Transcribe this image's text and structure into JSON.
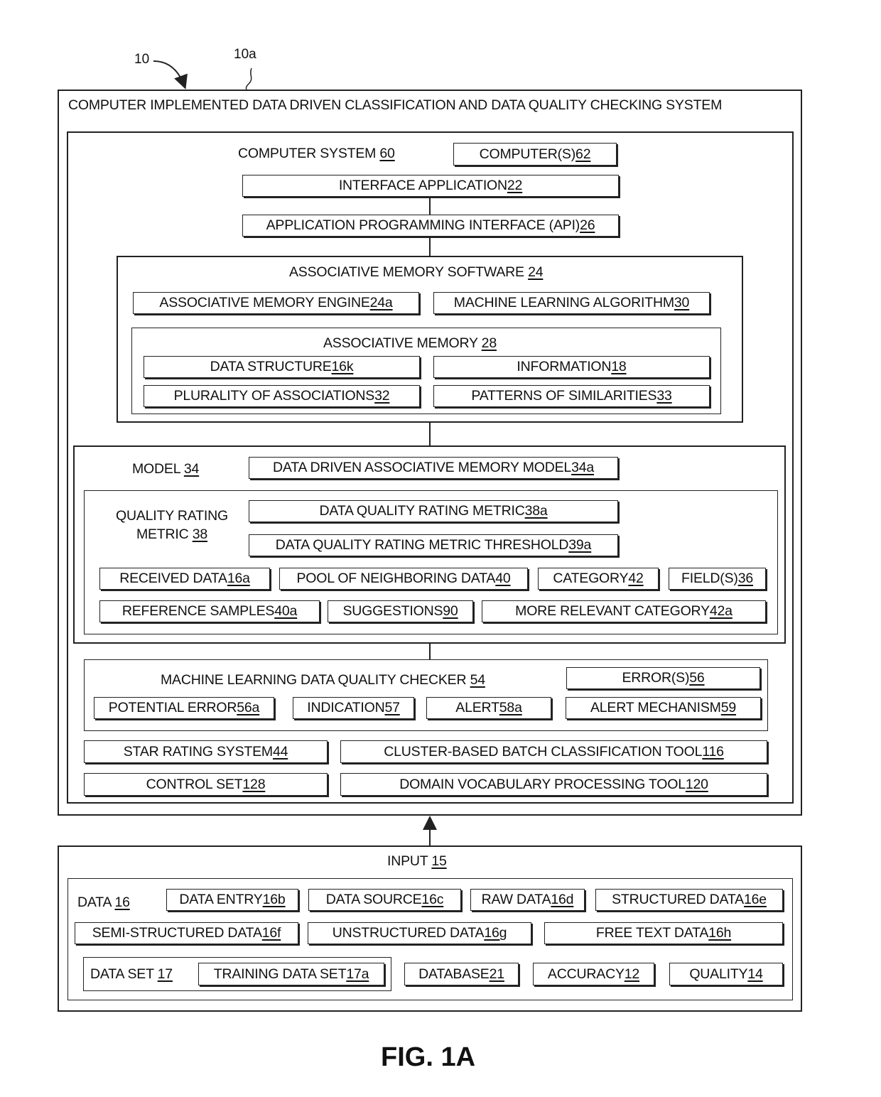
{
  "callouts": {
    "system_ref": "10",
    "frame_ref": "10a"
  },
  "system": {
    "title": "COMPUTER IMPLEMENTED DATA DRIVEN CLASSIFICATION AND DATA QUALITY CHECKING SYSTEM"
  },
  "computer_system": {
    "label": "COMPUTER SYSTEM ",
    "ref": "60",
    "computers": {
      "label": "COMPUTER(S) ",
      "ref": "62"
    },
    "interface_app": {
      "label": "INTERFACE APPLICATION ",
      "ref": "22"
    },
    "api": {
      "label": "APPLICATION PROGRAMMING INTERFACE (API) ",
      "ref": "26"
    }
  },
  "am_software": {
    "label": "ASSOCIATIVE MEMORY SOFTWARE ",
    "ref": "24",
    "engine": {
      "label": "ASSOCIATIVE MEMORY ENGINE ",
      "ref": "24a"
    },
    "ml_algo": {
      "label": "MACHINE LEARNING ALGORITHM ",
      "ref": "30"
    },
    "memory": {
      "label": "ASSOCIATIVE MEMORY ",
      "ref": "28",
      "data_structure": {
        "label": "DATA STRUCTURE ",
        "ref": "16k"
      },
      "information": {
        "label": "INFORMATION ",
        "ref": "18"
      },
      "associations": {
        "label": "PLURALITY OF ASSOCIATIONS ",
        "ref": "32"
      },
      "patterns": {
        "label": "PATTERNS OF SIMILARITIES ",
        "ref": "33"
      }
    }
  },
  "model": {
    "label": "MODEL ",
    "ref": "34",
    "dd_model": {
      "label": "DATA DRIVEN ASSOCIATIVE MEMORY MODEL ",
      "ref": "34a"
    },
    "qrm": {
      "label_line1": "QUALITY RATING",
      "label_line2": "METRIC ",
      "ref": "38",
      "dqrm": {
        "label": "DATA QUALITY RATING METRIC ",
        "ref": "38a"
      },
      "threshold": {
        "label": "DATA QUALITY RATING METRIC THRESHOLD ",
        "ref": "39a"
      },
      "received": {
        "label": "RECEIVED DATA ",
        "ref": "16a"
      },
      "pool": {
        "label": "POOL OF NEIGHBORING DATA ",
        "ref": "40"
      },
      "category": {
        "label": "CATEGORY ",
        "ref": "42"
      },
      "fields": {
        "label": "FIELD(S) ",
        "ref": "36"
      },
      "reference": {
        "label": "REFERENCE SAMPLES ",
        "ref": "40a"
      },
      "suggestions": {
        "label": "SUGGESTIONS ",
        "ref": "90"
      },
      "more_relevant": {
        "label": "MORE RELEVANT CATEGORY ",
        "ref": "42a"
      }
    }
  },
  "checker": {
    "label": "MACHINE LEARNING DATA QUALITY CHECKER ",
    "ref": "54",
    "errors": {
      "label": "ERROR(S) ",
      "ref": "56"
    },
    "potential": {
      "label": "POTENTIAL ERROR ",
      "ref": "56a"
    },
    "indication": {
      "label": "INDICATION ",
      "ref": "57"
    },
    "alert": {
      "label": "ALERT ",
      "ref": "58a"
    },
    "alert_mech": {
      "label": "ALERT MECHANISM ",
      "ref": "59"
    }
  },
  "tools": {
    "star": {
      "label": "STAR RATING SYSTEM ",
      "ref": "44"
    },
    "cluster": {
      "label": "CLUSTER-BASED BATCH CLASSIFICATION TOOL ",
      "ref": "116"
    },
    "control": {
      "label": "CONTROL SET ",
      "ref": "128"
    },
    "domain": {
      "label": "DOMAIN VOCABULARY PROCESSING TOOL ",
      "ref": "120"
    }
  },
  "input": {
    "label": "INPUT  ",
    "ref": "15",
    "data": {
      "label": "DATA ",
      "ref": "16"
    },
    "data_entry": {
      "label": "DATA ENTRY ",
      "ref": "16b"
    },
    "data_source": {
      "label": "DATA SOURCE ",
      "ref": "16c"
    },
    "raw": {
      "label": "RAW DATA ",
      "ref": "16d"
    },
    "structured": {
      "label": "STRUCTURED DATA ",
      "ref": "16e"
    },
    "semi": {
      "label": "SEMI-STRUCTURED DATA ",
      "ref": "16f"
    },
    "unstructured": {
      "label": "UNSTRUCTURED DATA ",
      "ref": "16g"
    },
    "free_text": {
      "label": "FREE TEXT DATA ",
      "ref": "16h"
    },
    "data_set": {
      "label": "DATA SET ",
      "ref": "17"
    },
    "training": {
      "label": "TRAINING DATA SET ",
      "ref": "17a"
    },
    "database": {
      "label": "DATABASE ",
      "ref": "21"
    },
    "accuracy": {
      "label": "ACCURACY ",
      "ref": "12"
    },
    "quality": {
      "label": "QUALITY ",
      "ref": "14"
    }
  },
  "figure": {
    "caption": "FIG. 1A"
  }
}
